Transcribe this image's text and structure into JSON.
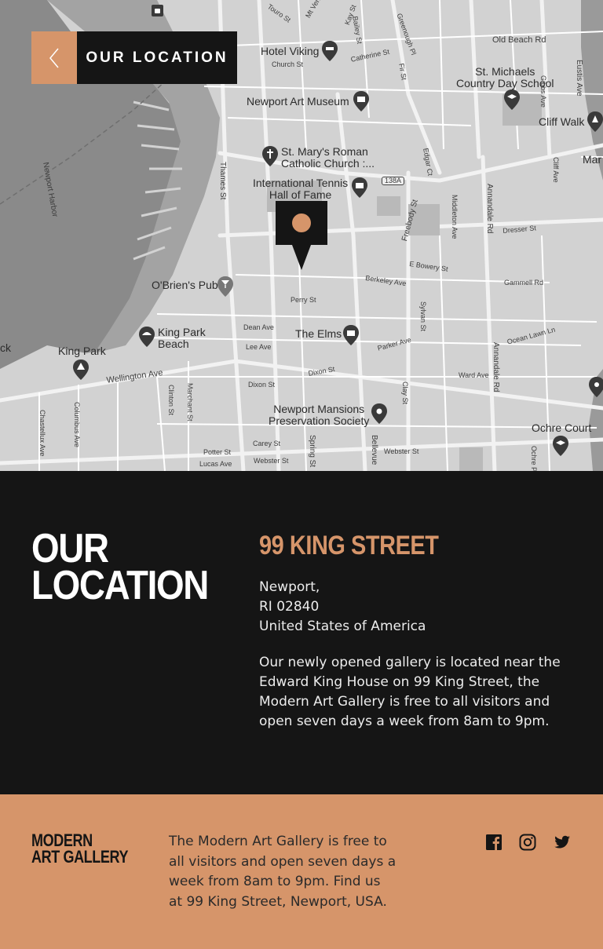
{
  "header": {
    "title": "OUR LOCATION",
    "back_icon": "chevron-left-icon"
  },
  "map": {
    "labels": {
      "hotel_viking": "Hotel Viking",
      "old_beach_rd": "Old Beach Rd",
      "st_michaels": "St. Michaels\nCountry Day School",
      "newport_art_museum": "Newport Art Museum",
      "cliff_walk": "Cliff Walk",
      "mar": "Mar",
      "st_marys": "St. Mary's Roman\nCatholic Church :...",
      "tennis_hof": "International Tennis\nHall of Fame",
      "route_138a": "138A",
      "newport_harbor": "Newport Harbor",
      "thames_st": "Thames St",
      "obriens_pub": "O'Brien's Pub",
      "perry_st": "Perry St",
      "king_park_beach": "King Park\nBeach",
      "king_park": "King Park",
      "ck": "ck",
      "the_elms": "The Elms",
      "wellington_ave": "Wellington Ave",
      "newport_mansions": "Newport Mansions\nPreservation Society",
      "ochre_court": "Ochre Court",
      "church_st": "Church St",
      "catherine_st": "Catherine St",
      "touro_st": "Touro St",
      "kay_st": "Kay St",
      "bowery_st": "E Bowery St",
      "berkeley_ave": "Berkeley Ave",
      "dresser_st": "Dresser St",
      "gammell_rd": "Gammell Rd",
      "dean_ave": "Dean Ave",
      "lee_ave": "Lee Ave",
      "parker_ave": "Parker Ave",
      "dixon_st": "Dixon St",
      "dixon_st_2": "Dixon St",
      "ward_ave": "Ward Ave",
      "ocean_lawn": "Ocean Lawn Ln",
      "carey_st": "Carey St",
      "potter_st": "Potter St",
      "webster_st": "Webster St",
      "webster_st_2": "Webster St",
      "lucas_ave": "Lucas Ave",
      "annandale_rd": "Annandale Rd",
      "annandale_rd_2": "Annandale Rd",
      "freebody_st": "Freebody St",
      "spring_st": "Spring St",
      "bellevue": "Bellevue",
      "clay_st": "Clay St",
      "sylvan_st": "Sylvan St",
      "middleton_ave": "Middleton Ave",
      "cliff_ave": "Cliff Ave",
      "gibbs_ave": "Gibbs Ave",
      "eustis_ave": "Eustis Ave",
      "marchant_st": "Marchant St",
      "clinton_st": "Clinton St",
      "columbus_ave": "Columbus Ave",
      "chastellux_ave": "Chastellux Ave",
      "edgar_ct": "Edgar Ct",
      "fir_st": "Fir St",
      "greenough_pl": "Greenough Pl",
      "bailey_st": "Bailey St",
      "mt_vernon": "Mt Vernon",
      "ochre_pt": "Ochre Pt"
    }
  },
  "location": {
    "heading": "OUR\nLOCATION",
    "street": "99 KING STREET",
    "address_lines": [
      "Newport,",
      "RI 02840",
      "United States of America"
    ],
    "description": "Our newly opened gallery is located near the Edward King House on 99 King Street, the Modern Art Gallery is free to all visitors and open seven days a week from 8am to 9pm."
  },
  "footer": {
    "logo_line1": "MODERN",
    "logo_line2": "ART GALLERY",
    "text": "The Modern Art Gallery is free to all visitors and open seven days a week from 8am to 9pm. Find us at 99 King Street, Newport, USA.",
    "social_icons": [
      "facebook-icon",
      "instagram-icon",
      "twitter-icon"
    ]
  },
  "colors": {
    "accent": "#d6956a",
    "dark": "#151515",
    "white": "#ffffff"
  }
}
